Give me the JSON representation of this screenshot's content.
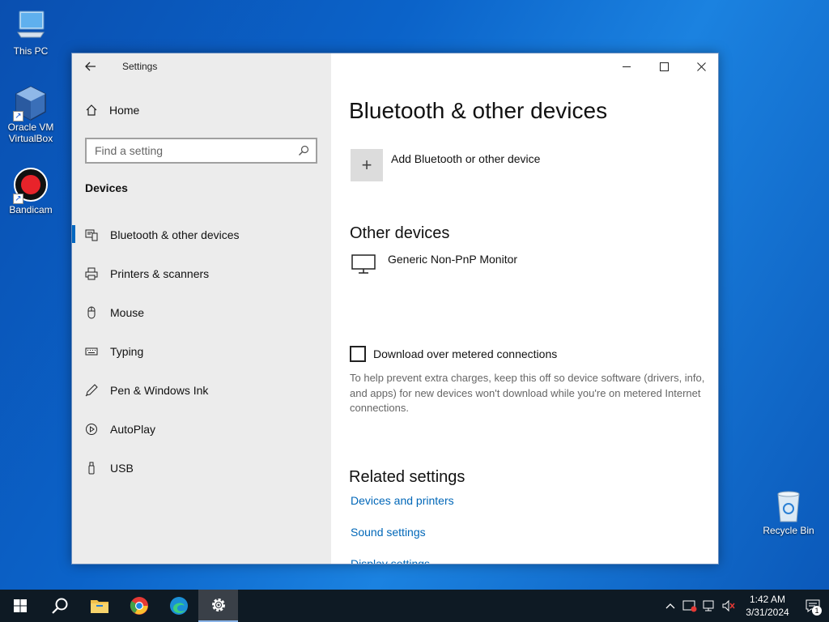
{
  "desktop": {
    "icons": [
      {
        "label": "This PC"
      },
      {
        "label": "Oracle VM VirtualBox"
      },
      {
        "label": "Bandicam"
      },
      {
        "label": "Recycle Bin"
      }
    ]
  },
  "window": {
    "title": "Settings",
    "sidebar": {
      "home_label": "Home",
      "search_placeholder": "Find a setting",
      "section_label": "Devices",
      "items": [
        {
          "label": "Bluetooth & other devices",
          "icon": "bluetooth-devices-icon",
          "active": true
        },
        {
          "label": "Printers & scanners",
          "icon": "printer-icon"
        },
        {
          "label": "Mouse",
          "icon": "mouse-icon"
        },
        {
          "label": "Typing",
          "icon": "keyboard-icon"
        },
        {
          "label": "Pen & Windows Ink",
          "icon": "pen-icon"
        },
        {
          "label": "AutoPlay",
          "icon": "autoplay-icon"
        },
        {
          "label": "USB",
          "icon": "usb-icon"
        }
      ]
    },
    "main": {
      "heading": "Bluetooth & other devices",
      "add_device_label": "Add Bluetooth or other device",
      "other_devices_heading": "Other devices",
      "devices": [
        {
          "name": "Generic Non-PnP Monitor",
          "icon": "monitor-icon"
        }
      ],
      "metered_checkbox": {
        "label": "Download over metered connections",
        "checked": false,
        "help": "To help prevent extra charges, keep this off so device software (drivers, info, and apps) for new devices won't download while you're on metered Internet connections."
      },
      "related_heading": "Related settings",
      "related_links": [
        "Devices and printers",
        "Sound settings",
        "Display settings"
      ]
    }
  },
  "taskbar": {
    "apps": [
      "start",
      "search",
      "file-explorer",
      "chrome",
      "edge",
      "settings"
    ],
    "active_app": "settings",
    "clock": {
      "time": "1:42 AM",
      "date": "3/31/2024"
    },
    "notification_count": "1"
  },
  "colors": {
    "accent": "#0067c0",
    "link": "#0067b8",
    "sidebar_bg": "#ececec",
    "taskbar_bg": "#0e1a24"
  }
}
